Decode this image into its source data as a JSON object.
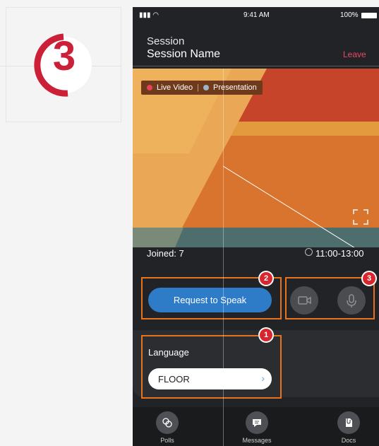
{
  "step": {
    "number": "3"
  },
  "status_bar": {
    "time": "9:41 AM",
    "battery": "100%"
  },
  "header": {
    "subtitle": "Session",
    "title": "Session Name",
    "leave_label": "Leave"
  },
  "video": {
    "modes": [
      {
        "label": "Live Video",
        "color": "#e8425a"
      },
      {
        "label": "Presentation",
        "color": "#9fb3c6"
      }
    ],
    "expand_icon": "fullscreen-icon"
  },
  "stats": {
    "joined": "Joined: 7",
    "time": "11:00-13:00"
  },
  "actions": {
    "request_label": "Request to Speak",
    "camera_icon": "camera-icon",
    "mic_icon": "microphone-icon"
  },
  "language": {
    "label": "Language",
    "value": "FLOOR"
  },
  "annotations": [
    {
      "number": "1"
    },
    {
      "number": "2"
    },
    {
      "number": "3"
    }
  ],
  "tabs": [
    {
      "label": "Polls",
      "icon": "polls-icon"
    },
    {
      "label": "Messages",
      "icon": "messages-icon"
    },
    {
      "label": "Docs",
      "icon": "docs-icon"
    }
  ],
  "colors": {
    "accent": "#2e7cc8",
    "leave": "#e84a63",
    "annotation": "#e9731c",
    "badge": "#d8262e"
  }
}
